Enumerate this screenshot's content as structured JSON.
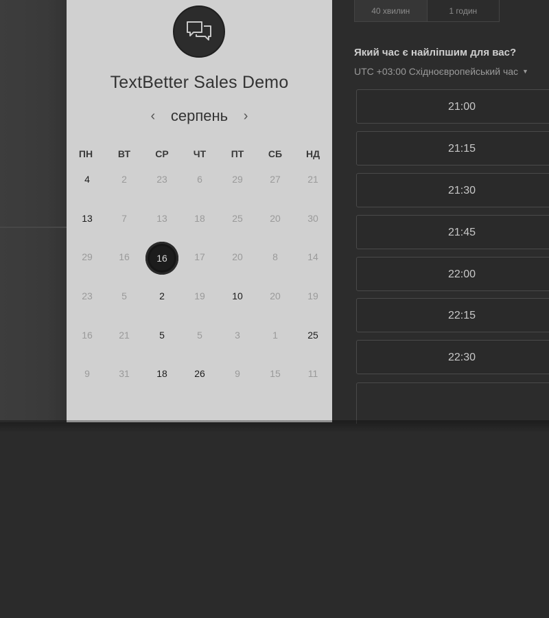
{
  "event": {
    "title": "TextBetter Sales Demo"
  },
  "calendar": {
    "month": "серпень",
    "weekdays": [
      "ПН",
      "ВТ",
      "СР",
      "ЧТ",
      "ПТ",
      "СБ",
      "НД"
    ],
    "weeks": [
      [
        "4",
        "2",
        "23",
        "6",
        "29",
        "27",
        "21"
      ],
      [
        "13",
        "7",
        "13",
        "18",
        "25",
        "20",
        "30"
      ],
      [
        "29",
        "16",
        "16",
        "17",
        "20",
        "8",
        "14"
      ],
      [
        "23",
        "5",
        "2",
        "19",
        "10",
        "20",
        "19"
      ],
      [
        "16",
        "21",
        "5",
        "5",
        "3",
        "1",
        "25"
      ],
      [
        "9",
        "31",
        "18",
        "26",
        "9",
        "15",
        "11"
      ]
    ],
    "selected_day": "16"
  },
  "durations": [
    "40 хвилин",
    "1 годин"
  ],
  "time_question": "Який час є найліпшим для вас?",
  "timezone": "UTC +03:00 Східноєвропейський час",
  "time_slots": [
    "21:00",
    "21:15",
    "21:30",
    "21:45",
    "22:00",
    "22:15",
    "22:30"
  ]
}
